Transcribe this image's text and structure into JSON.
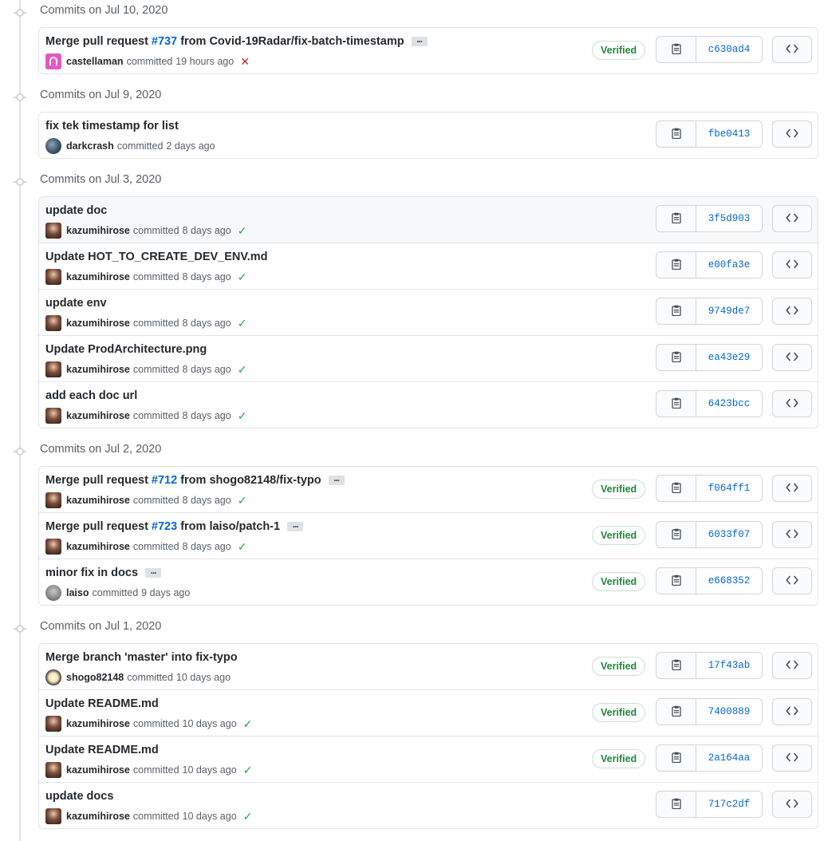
{
  "colors": {
    "link": "#0366d6",
    "verified": "#22863a",
    "success": "#28a745",
    "failure": "#cb2431"
  },
  "icons": {
    "copy": "clipboard-icon",
    "browse": "code-icon",
    "timeline": "git-commit-icon",
    "success": "check-icon",
    "failure": "x-icon"
  },
  "labels": {
    "committed": "committed",
    "verified": "Verified"
  },
  "groups": [
    {
      "date": "Commits on Jul 10, 2020",
      "commits": [
        {
          "title_before": "Merge pull request",
          "pr": "#737",
          "title_after": "from Covid-19Radar/fix-batch-timestamp",
          "has_ellipsis": true,
          "author": "castellaman",
          "avatar": "pink",
          "time": "19 hours ago",
          "status": "fail",
          "verified": true,
          "sha": "c630ad4"
        }
      ]
    },
    {
      "date": "Commits on Jul 9, 2020",
      "commits": [
        {
          "title_before": "fix tek timestamp for list",
          "author": "darkcrash",
          "avatar": "photo-dark",
          "time": "2 days ago",
          "status": "none",
          "verified": false,
          "sha": "fbe0413"
        }
      ]
    },
    {
      "date": "Commits on Jul 3, 2020",
      "commits": [
        {
          "title_before": "update doc",
          "author": "kazumihirose",
          "avatar": "photo-kaz",
          "time": "8 days ago",
          "status": "ok",
          "verified": false,
          "sha": "3f5d903",
          "hover": true
        },
        {
          "title_before": "Update HOT_TO_CREATE_DEV_ENV.md",
          "author": "kazumihirose",
          "avatar": "photo-kaz",
          "time": "8 days ago",
          "status": "ok",
          "verified": false,
          "sha": "e00fa3e"
        },
        {
          "title_before": "update env",
          "author": "kazumihirose",
          "avatar": "photo-kaz",
          "time": "8 days ago",
          "status": "ok",
          "verified": false,
          "sha": "9749de7"
        },
        {
          "title_before": "Update ProdArchitecture.png",
          "author": "kazumihirose",
          "avatar": "photo-kaz",
          "time": "8 days ago",
          "status": "ok",
          "verified": false,
          "sha": "ea43e29"
        },
        {
          "title_before": "add each doc url",
          "author": "kazumihirose",
          "avatar": "photo-kaz",
          "time": "8 days ago",
          "status": "ok",
          "verified": false,
          "sha": "6423bcc"
        }
      ]
    },
    {
      "date": "Commits on Jul 2, 2020",
      "commits": [
        {
          "title_before": "Merge pull request",
          "pr": "#712",
          "title_after": "from shogo82148/fix-typo",
          "has_ellipsis": true,
          "author": "kazumihirose",
          "avatar": "photo-kaz",
          "time": "8 days ago",
          "status": "ok",
          "verified": true,
          "sha": "f064ff1"
        },
        {
          "title_before": "Merge pull request",
          "pr": "#723",
          "title_after": "from laiso/patch-1",
          "has_ellipsis": true,
          "author": "kazumihirose",
          "avatar": "photo-kaz",
          "time": "8 days ago",
          "status": "ok",
          "verified": true,
          "sha": "6033f07"
        },
        {
          "title_before": "minor fix in docs",
          "has_ellipsis": true,
          "author": "laiso",
          "avatar": "photo-laiso",
          "time": "9 days ago",
          "status": "none",
          "verified": true,
          "sha": "e668352"
        }
      ]
    },
    {
      "date": "Commits on Jul 1, 2020",
      "commits": [
        {
          "title_before": "Merge branch 'master' into fix-typo",
          "author": "shogo82148",
          "avatar": "photo-shogo",
          "time": "10 days ago",
          "status": "none",
          "verified": true,
          "sha": "17f43ab"
        },
        {
          "title_before": "Update README.md",
          "author": "kazumihirose",
          "avatar": "photo-kaz",
          "time": "10 days ago",
          "status": "ok",
          "verified": true,
          "sha": "7400889"
        },
        {
          "title_before": "Update README.md",
          "author": "kazumihirose",
          "avatar": "photo-kaz",
          "time": "10 days ago",
          "status": "ok",
          "verified": true,
          "sha": "2a164aa"
        },
        {
          "title_before": "update docs",
          "author": "kazumihirose",
          "avatar": "photo-kaz",
          "time": "10 days ago",
          "status": "ok",
          "verified": false,
          "sha": "717c2df"
        }
      ]
    }
  ]
}
